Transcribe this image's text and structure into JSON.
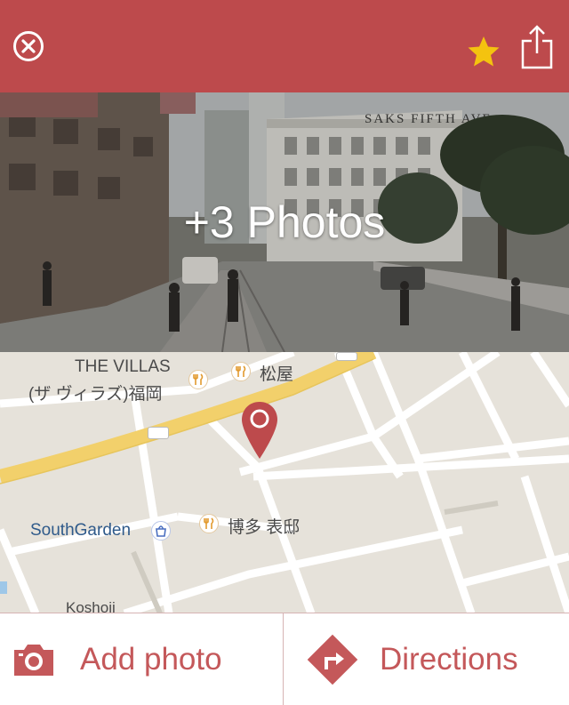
{
  "header": {
    "close_icon": "close-icon",
    "favorite_icon": "star-icon",
    "share_icon": "share-icon",
    "accent_color": "#bd4a4c",
    "star_color": "#f4c30f"
  },
  "photo": {
    "overlay_text": "+3 Photos",
    "sign_text": "SAKS FIFTH AVE"
  },
  "map": {
    "labels": {
      "villas_en": "THE VILLAS",
      "villas_jp": "(ザ ヴィラズ)福岡",
      "matsuya": "松屋",
      "southgarden": "SouthGarden",
      "hakata": "博多 表邸",
      "koshoji": "Koshoji"
    },
    "pin_color": "#bd4a4c",
    "road_color": "#f2d06b"
  },
  "actions": {
    "add_photo": "Add photo",
    "directions": "Directions"
  }
}
